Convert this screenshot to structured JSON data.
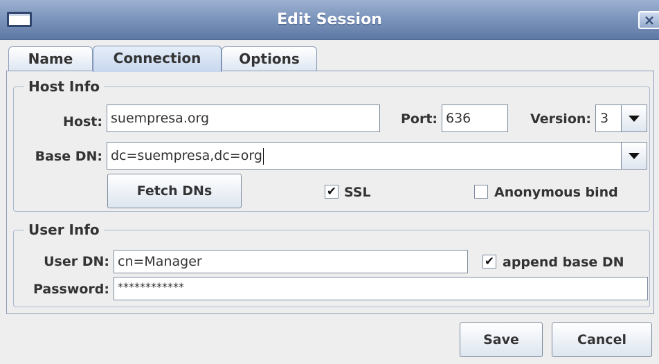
{
  "window": {
    "title": "Edit Session",
    "close_glyph": "×"
  },
  "tabs": [
    {
      "label": "Name"
    },
    {
      "label": "Connection"
    },
    {
      "label": "Options"
    }
  ],
  "host_info": {
    "legend": "Host Info",
    "host_label": "Host:",
    "host_value": "suempresa.org",
    "port_label": "Port:",
    "port_value": "636",
    "version_label": "Version:",
    "version_value": "3",
    "base_dn_label": "Base DN:",
    "base_dn_value": "dc=suempresa,dc=org",
    "fetch_dns_label": "Fetch DNs",
    "ssl_label": "SSL",
    "ssl_checked": true,
    "anonymous_label": "Anonymous bind",
    "anonymous_checked": false
  },
  "user_info": {
    "legend": "User Info",
    "user_dn_label": "User DN:",
    "user_dn_value": "cn=Manager",
    "append_label": "append base DN",
    "append_checked": true,
    "password_label": "Password:",
    "password_value": "************"
  },
  "footer": {
    "save_label": "Save",
    "cancel_label": "Cancel"
  },
  "check_glyph": "✔"
}
